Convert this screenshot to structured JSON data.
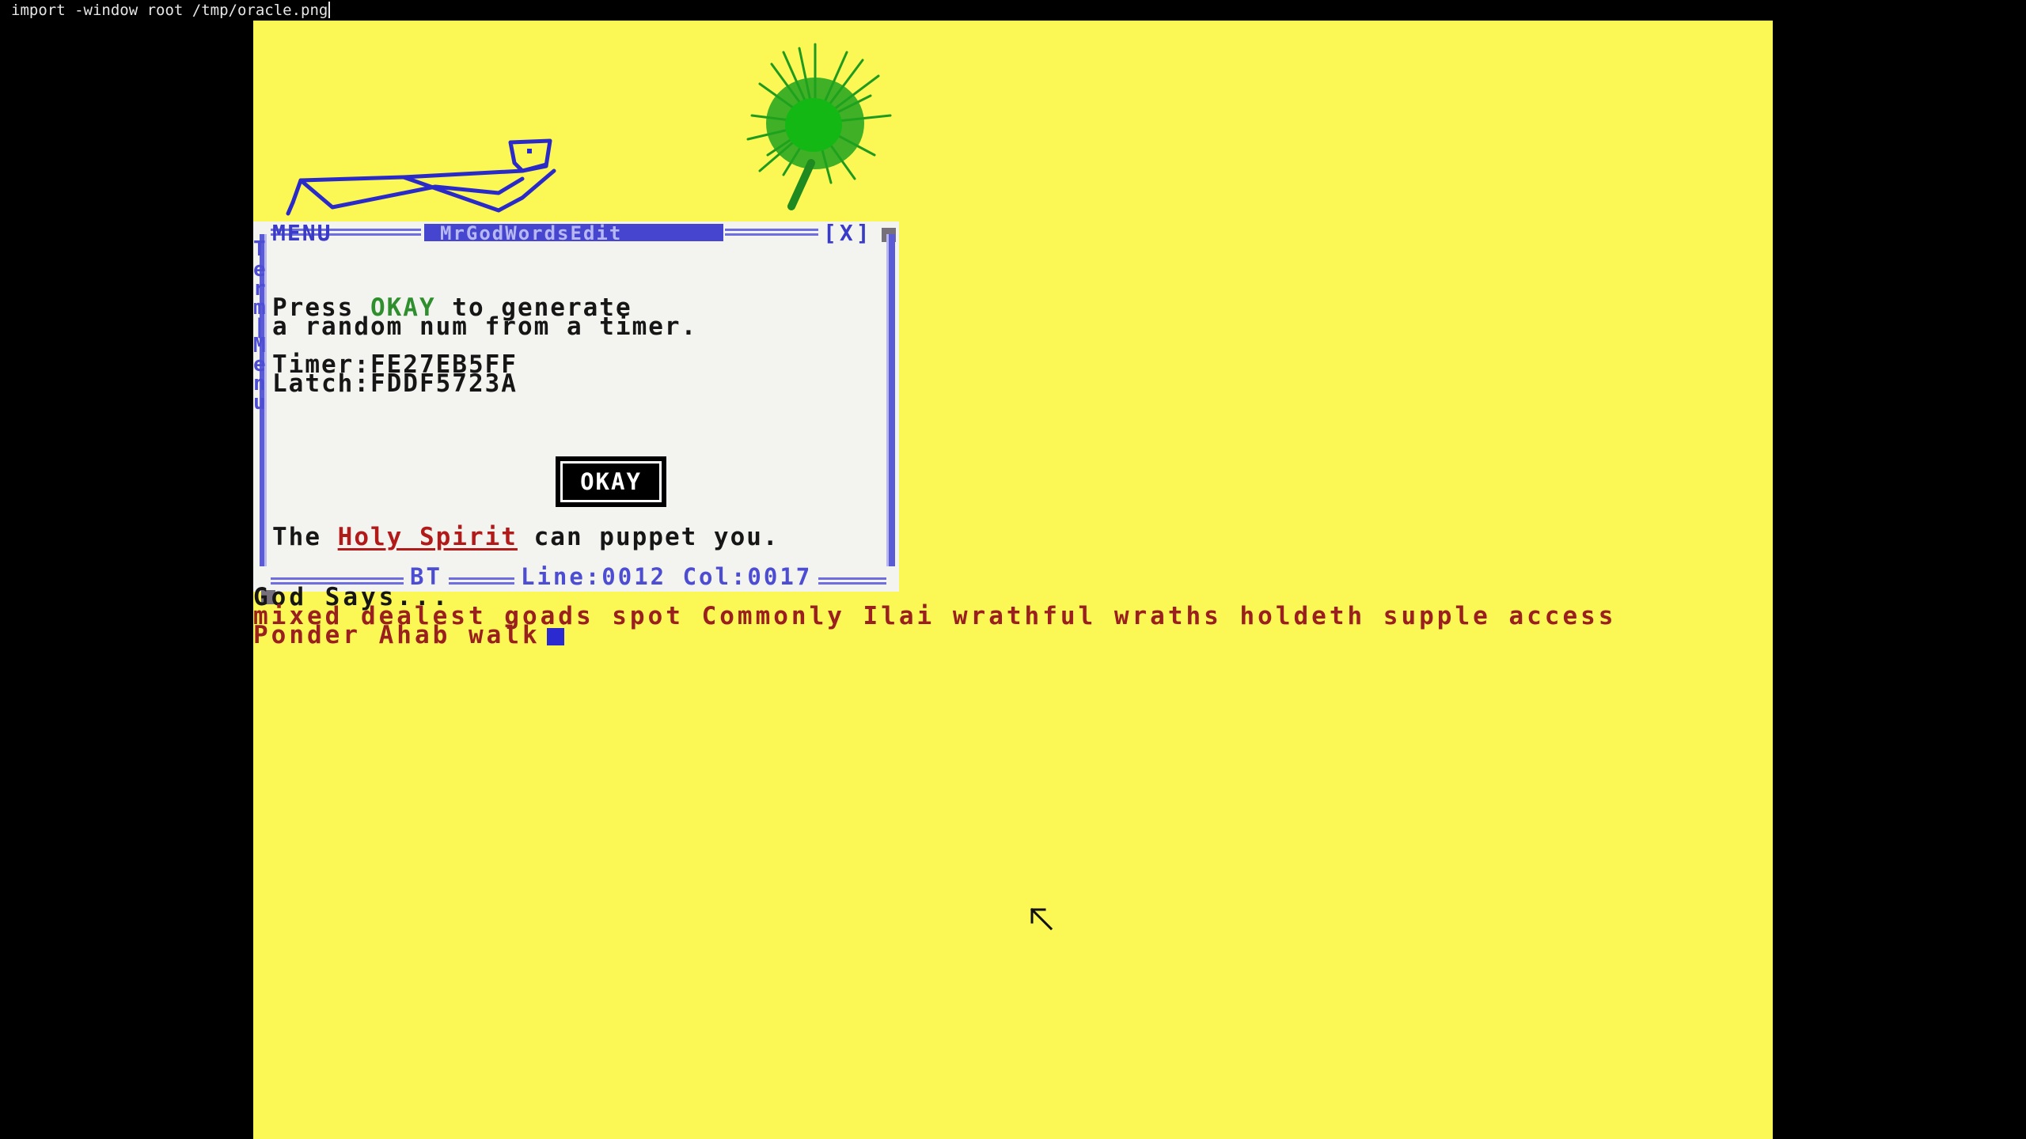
{
  "terminal": {
    "command": "import -window root /tmp/oracle.png"
  },
  "colors": {
    "screen_background": "#fbf754",
    "window_frame": "#5b5bd6",
    "link_red": "#b21a1a",
    "okay_green": "#2f8f2f"
  },
  "popup": {
    "menu_label": "MENU",
    "title": "MrGodWordsEdit",
    "close_label": "[X]",
    "side_letters": [
      "T",
      "e",
      "r",
      "m",
      "|",
      "M",
      "e",
      "n",
      "u"
    ],
    "line1_prefix": "Press ",
    "line1_keyword": "OKAY",
    "line1_suffix": " to generate",
    "line2": "a random num from a timer.",
    "timer_line": "Timer:FE27EB5FF",
    "latch_line": "Latch:FDDF5723A",
    "okay_button_label": "OKAY",
    "spirit_prefix": "The ",
    "spirit_link": "Holy Spirit",
    "spirit_suffix": " can puppet you.",
    "status_mode": "BT",
    "status_position": "Line:0012 Col:0017"
  },
  "terminal_output": {
    "god_says": "God Says...",
    "words": "mixed dealest goads spot Commonly Ilai wrathful wraths holdeth supple access",
    "prompt": "Ponder Ahab walk"
  },
  "icons": {
    "sprite_figure": "stick-figure-icon",
    "sprite_tree": "palm-tree-icon",
    "pointer": "mouse-pointer-icon"
  }
}
